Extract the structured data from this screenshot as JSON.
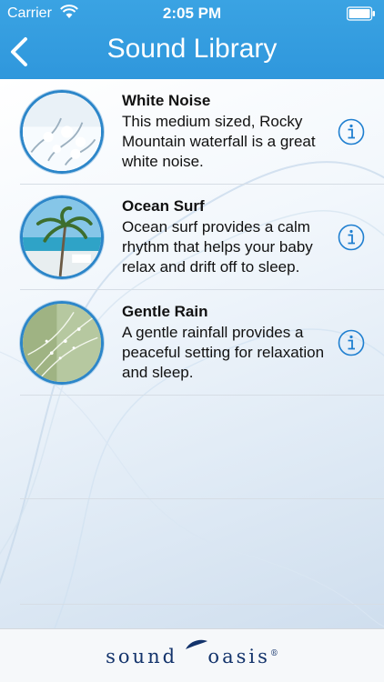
{
  "status_bar": {
    "carrier": "Carrier",
    "time": "2:05 PM"
  },
  "header": {
    "title": "Sound Library",
    "back_icon": "chevron-left-icon"
  },
  "sounds": [
    {
      "title": "White Noise",
      "description": "This medium sized, Rocky Mountain waterfall is a great white noise.",
      "thumbnail": "snowy-branches"
    },
    {
      "title": "Ocean Surf",
      "description": "Ocean surf provides a calm rhythm that helps your baby relax and drift off to sleep.",
      "thumbnail": "palm-tree-beach"
    },
    {
      "title": "Gentle Rain",
      "description": "A gentle rainfall provides a peaceful setting for relaxation and sleep.",
      "thumbnail": "rain-on-grass"
    }
  ],
  "footer": {
    "brand_left": "sound",
    "brand_right": "oasis",
    "brand_mark": "®"
  },
  "colors": {
    "header": "#3aa3e3",
    "accent": "#2c86c9",
    "brand": "#13336b"
  }
}
